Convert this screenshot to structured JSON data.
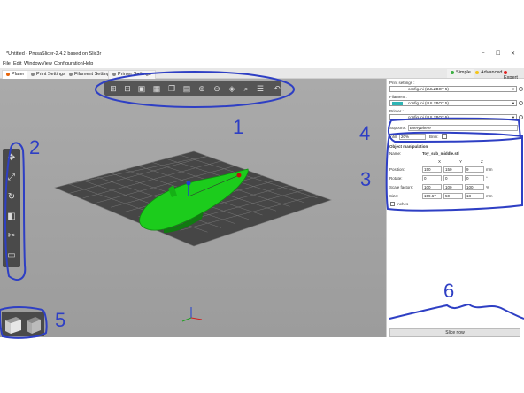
{
  "window": {
    "title": "*Untitled - PrusaSlicer-2.4.2 based on Slic3r",
    "controls": [
      "–",
      "☐",
      "✕"
    ]
  },
  "menu": [
    "File",
    "Edit",
    "Window",
    "View",
    "Configuration",
    "Help"
  ],
  "tabs": [
    {
      "label": "Plater",
      "dot": "#e8650a"
    },
    {
      "label": "Print Settings",
      "dot": "#888888"
    },
    {
      "label": "Filament Settings",
      "dot": "#888888"
    },
    {
      "label": "Printer Settings",
      "dot": "#888888"
    }
  ],
  "modes": [
    {
      "label": "Simple",
      "dot": "#3cb043"
    },
    {
      "label": "Advanced",
      "dot": "#f5c518"
    },
    {
      "label": "Expert",
      "dot": "#e02020"
    }
  ],
  "toolbar_icons": [
    "add-icon",
    "delete-icon",
    "delete-all-icon",
    "arrange-icon",
    "copy-icon",
    "paste-icon",
    "add-instance-icon",
    "remove-instance-icon",
    "split-icon",
    "search-icon",
    "layers-icon",
    "undo-icon"
  ],
  "left_tools": [
    "move-icon",
    "scale-icon",
    "rotate-icon",
    "place-on-face-icon",
    "cut-icon",
    "paint-icon"
  ],
  "panel": {
    "print_settings_label": "Print settings :",
    "print_profile": "config.ini (LULZBOT 5)",
    "filament_label": "Filament :",
    "filament_profile": "config.ini (LULZBOT 5)",
    "filament_color": "#2fb5b5",
    "printer_label": "Printer :",
    "printer_profile": "config.ini (LULZBOT 5)",
    "supports_label": "Supports:",
    "supports_value": "Everywhere",
    "infill_label": "Infill:",
    "infill_value": "20%",
    "brim_label": "Brim:",
    "object_manipulation_label": "Object manipulation",
    "name_label": "Name:",
    "name_value": "Toy_sub_middle.stl",
    "col_x": "X",
    "col_y": "Y",
    "col_z": "Z",
    "position_label": "Position:",
    "position": [
      "150",
      "150",
      "9"
    ],
    "rotate_label": "Rotate:",
    "rotate": [
      "0",
      "0",
      "0"
    ],
    "scale_label": "Scale factors:",
    "scale": [
      "100",
      "100",
      "100"
    ],
    "size_label": "Size:",
    "size": [
      "159.67",
      "50",
      "18"
    ],
    "unit_mm": "mm",
    "unit_deg": "°",
    "unit_pct": "%",
    "inches_label": "Inches",
    "slice_button": "Slice now"
  },
  "annotations": [
    "1",
    "2",
    "3",
    "4",
    "5",
    "6"
  ]
}
